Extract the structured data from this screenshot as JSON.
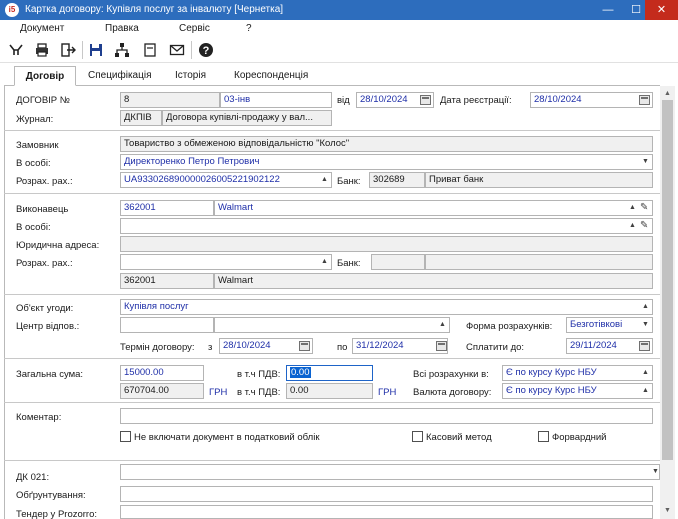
{
  "window": {
    "logo": "i5",
    "title": "Картка договору: Купівля послуг за інвалюту [Чернетка]",
    "minimize": "—",
    "maximize": "☐",
    "close": "✕"
  },
  "menu": [
    "Документ",
    "Правка",
    "Сервіс",
    "?"
  ],
  "toolbar": [
    "filter-icon",
    "print-icon",
    "exit-icon",
    "save-icon",
    "hierarchy-icon",
    "document-icon",
    "envelope-icon",
    "help-icon"
  ],
  "tabs": [
    "Договір",
    "Специфікація",
    "Історія",
    "Кореспонденція"
  ],
  "header": {
    "contract_label": "ДОГОВІР №",
    "number": "8",
    "series": "03-інв",
    "from_label": "від",
    "date": "28/10/2024",
    "reg_label": "Дата реєстрації:",
    "reg_date": "28/10/2024",
    "journal_label": "Журнал:",
    "journal_code": "ДКПІВ",
    "journal_name": "Договора купівлі-продажу у вал..."
  },
  "customer": {
    "label": "Замовник",
    "value": "Товариство з обмеженою відповідальністю \"Колос\"",
    "person_label": "В особі:",
    "person": "Директоренко Петро Петрович",
    "account_label": "Розрах. рах.:",
    "account": "UA933026890000026005221902122",
    "bank_label": "Банк:",
    "bank_code": "302689",
    "bank_name": "Приват банк"
  },
  "executor": {
    "label": "Виконавець",
    "code": "362001",
    "name": "Walmart",
    "person_label": "В особі:",
    "person": "",
    "legal_label": "Юридична адреса:",
    "legal": "",
    "account_label": "Розрах. рах.:",
    "account": "",
    "bank_label": "Банк:",
    "bank_code": "",
    "bank_name": "",
    "code2": "362001",
    "name2": "Walmart"
  },
  "subject": {
    "label": "Об'єкт угоди:",
    "value": "Купівля послуг",
    "center_label": "Центр відпов.:",
    "center_code": "",
    "center_name": "",
    "payment_form_label": "Форма розрахунків:",
    "payment_form": "Безготівкові",
    "term_label": "Термін договору:",
    "from_label": "з",
    "term_from": "28/10/2024",
    "to_label": "по",
    "term_to": "31/12/2024",
    "pay_until_label": "Сплатити до:",
    "pay_until": "29/11/2024"
  },
  "sum": {
    "total_label": "Загальна сума:",
    "total": "15000.00",
    "vat_label": "в т.ч ПДВ:",
    "vat": "0.00",
    "all_payments_label": "Всі розрахунки в:",
    "all_payments": "Є по курсу Курс НБУ",
    "uah_total": "670704.00",
    "uah_label": "ГРН",
    "vat2_label": "в т.ч ПДВ:",
    "vat2": "0.00",
    "uah_label2": "ГРН",
    "currency_label": "Валюта договору:",
    "currency": "Є по курсу Курс НБУ"
  },
  "comment": {
    "label": "Коментар:",
    "value": "",
    "tax_check": "Не включати документ в податковий облік",
    "cash_check": "Касовий метод",
    "forward_check": "Форвардний"
  },
  "extra": {
    "dk_label": "ДК 021:",
    "dk": "",
    "justification_label": "Обґрунтування:",
    "justification": "",
    "tender_label": "Тендер у Prozorro:"
  },
  "colors": {
    "titlebar": "#2d6dbd",
    "close": "#c42b1c",
    "link": "#1f2fa8",
    "selection": "#0a63d1"
  }
}
